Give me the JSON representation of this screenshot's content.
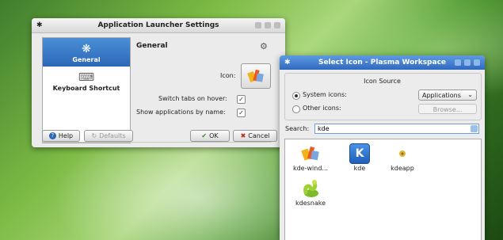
{
  "settings_window": {
    "title": "Application Launcher Settings",
    "sidebar": [
      {
        "label": "General",
        "icon": "gear-icon",
        "glyph": "❋"
      },
      {
        "label": "Keyboard Shortcut",
        "icon": "keyboard-icon",
        "glyph": "⌨"
      }
    ],
    "section_title": "General",
    "icon_label": "Icon:",
    "switch_tabs_label": "Switch tabs on hover:",
    "show_apps_label": "Show applications by name:",
    "check_mark": "✓",
    "buttons": {
      "help": "Help",
      "defaults": "Defaults",
      "ok": "OK",
      "cancel": "Cancel"
    },
    "button_glyphs": {
      "help": "?",
      "defaults": "↻",
      "ok": "✔",
      "cancel": "✖"
    }
  },
  "select_icon_window": {
    "title": "Select Icon - Plasma Workspace",
    "icon_source_title": "Icon Source",
    "system_icons_label": "System icons:",
    "other_icons_label": "Other icons:",
    "category_value": "Applications",
    "combo_arrow": "⌄",
    "browse_label": "Browse...",
    "search_label": "Search:",
    "search_value": "kde",
    "icons": [
      {
        "label": "kde-wind...",
        "icon": "kde-windows-icon"
      },
      {
        "label": "kde",
        "icon": "kde-logo-icon"
      },
      {
        "label": "kdeapp",
        "icon": "kdeapp-icon"
      },
      {
        "label": "kdesnake",
        "icon": "kdesnake-icon"
      }
    ],
    "kde_glyph": "K"
  },
  "colors": {
    "selection_blue": "#2b67b5",
    "titlebar_blue": "#2f69c0",
    "desktop_green": "#5aa23a"
  }
}
